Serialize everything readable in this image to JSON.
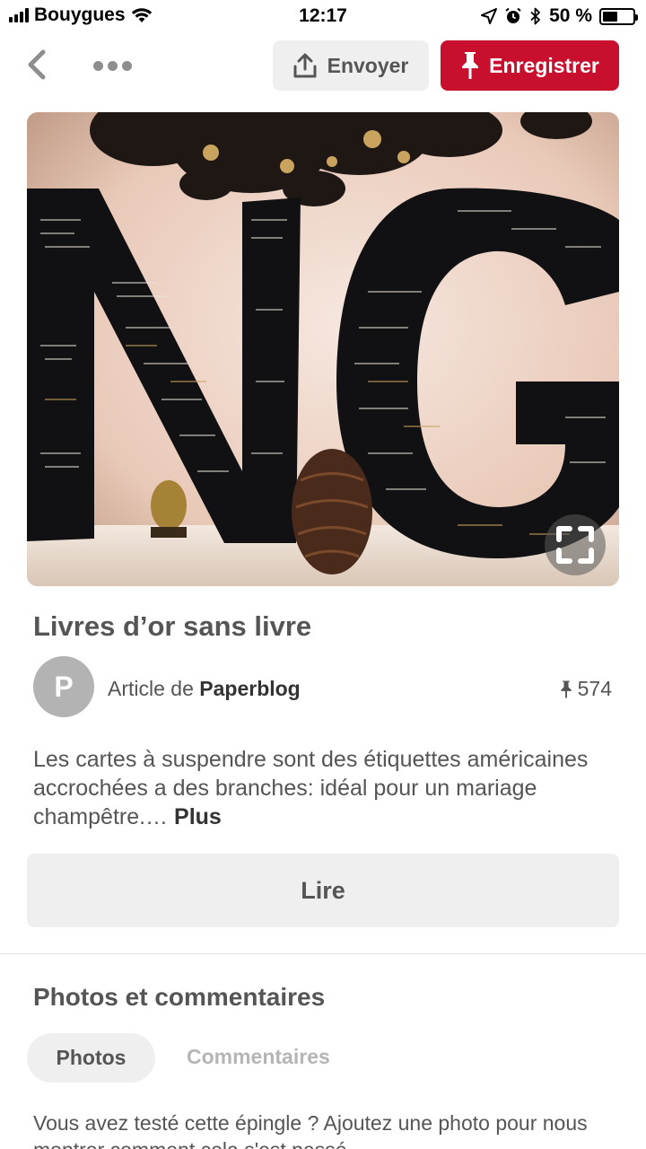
{
  "status_bar": {
    "carrier": "Bouygues",
    "time": "12:17",
    "battery_percent_text": "50 %",
    "battery_level": 0.5
  },
  "nav": {
    "send_label": "Envoyer",
    "save_label": "Enregistrer"
  },
  "pin": {
    "title": "Livres d’or sans livre",
    "source_prefix": "Article de",
    "source_name": "Paperblog",
    "avatar_letter": "P",
    "save_count": "574",
    "description": "Les cartes à suspendre sont des étiquettes américaines accrochées a des branches: idéal pour un mariage champêtre.… ",
    "more_label": "Plus",
    "read_label": "Lire"
  },
  "photos_section": {
    "title": "Photos et commentaires",
    "tabs": [
      "Photos",
      "Commentaires"
    ],
    "prompt": "Vous avez testé cette épingle ? Ajoutez une photo pour nous montrer comment cela s'est passé"
  },
  "colors": {
    "brand_red": "#c8102e",
    "button_gray": "#efefef"
  },
  "icons": [
    "back-chevron-icon",
    "more-dots-icon",
    "share-upload-icon",
    "pin-icon",
    "expand-icon",
    "location-arrow-icon",
    "alarm-icon",
    "bluetooth-icon",
    "wifi-icon"
  ]
}
